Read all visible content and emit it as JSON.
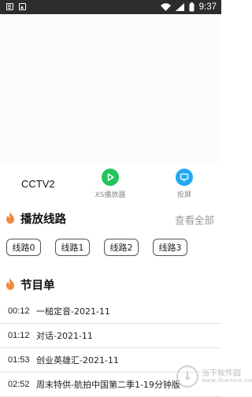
{
  "status_bar": {
    "time": "9:37"
  },
  "channel": {
    "name": "CCTV2",
    "actions": {
      "player_label": "XS播放器",
      "cast_label": "投屏"
    }
  },
  "routes_section": {
    "title": "播放线路",
    "more_label": "查看全部",
    "routes": [
      "线路0",
      "线路1",
      "线路2",
      "线路3"
    ]
  },
  "schedule_section": {
    "title": "节目单",
    "programs": [
      {
        "time": "00:12",
        "title": "一槌定音-2021-11"
      },
      {
        "time": "01:12",
        "title": "对话-2021-11"
      },
      {
        "time": "01:53",
        "title": "创业英雄汇-2021-11"
      },
      {
        "time": "02:52",
        "title": "周末特供-航拍中国第二季1-19分钟版"
      }
    ]
  },
  "watermark": {
    "text": "当下软件园",
    "sub": "www.downxia.com"
  },
  "colors": {
    "player_green": "#22c55e",
    "cast_blue": "#23a8f2",
    "flame_orange": "#f08a3c"
  }
}
